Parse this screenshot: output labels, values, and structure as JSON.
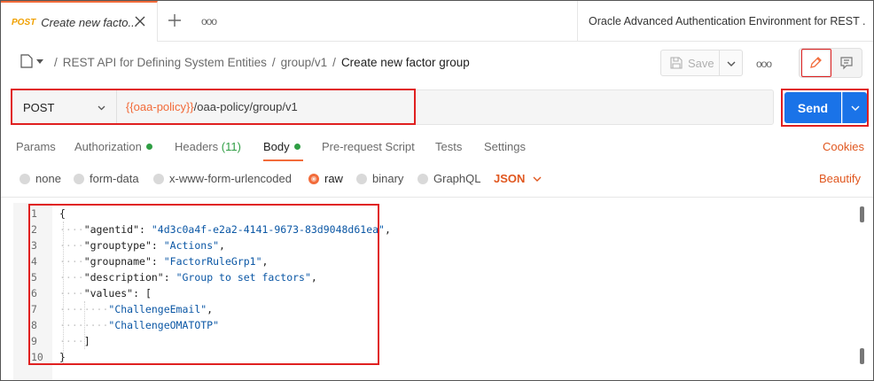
{
  "tab": {
    "method": "POST",
    "name": "Create new facto...",
    "method_color": "#f0a000"
  },
  "environment": {
    "name": "Oracle Advanced Authentication Environment for REST ."
  },
  "breadcrumb": {
    "collection": "REST API for Defining System Entities",
    "folder": "group/v1",
    "request": "Create new factor group",
    "sep": "/"
  },
  "toolbar": {
    "save_label": "Save"
  },
  "request": {
    "method": "POST",
    "url_variable": "{{oaa-policy}}",
    "url_path": "/oaa-policy/group/v1",
    "send_label": "Send"
  },
  "request_tabs": [
    {
      "label": "Params"
    },
    {
      "label": "Authorization"
    },
    {
      "label": "Headers"
    },
    {
      "label": "Body"
    },
    {
      "label": "Pre-request Script"
    },
    {
      "label": "Tests"
    },
    {
      "label": "Settings"
    }
  ],
  "headers_count": "(11)",
  "cookies_label": "Cookies",
  "body_options": [
    {
      "label": "none"
    },
    {
      "label": "form-data"
    },
    {
      "label": "x-www-form-urlencoded"
    },
    {
      "label": "raw"
    },
    {
      "label": "binary"
    },
    {
      "label": "GraphQL"
    }
  ],
  "body_format": "JSON",
  "beautify_label": "Beautify",
  "colors": {
    "accent": "#f26b3a",
    "send": "#1a73e8",
    "status_green": "#2f9e44",
    "highlight_red": "#e02020"
  },
  "code": {
    "line_numbers": [
      "1",
      "2",
      "3",
      "4",
      "5",
      "6",
      "7",
      "8",
      "9",
      "10"
    ],
    "open_brace": "{",
    "close_brace": "}",
    "agentid_key": "\"agentid\"",
    "agentid_val": "\"4d3c0a4f-e2a2-4141-9673-83d9048d61ea\"",
    "grouptype_key": "\"grouptype\"",
    "grouptype_val": "\"Actions\"",
    "groupname_key": "\"groupname\"",
    "groupname_val": "\"FactorRuleGrp1\"",
    "description_key": "\"description\"",
    "description_val": "\"Group to set factors\"",
    "values_key": "\"values\"",
    "values_open": "[",
    "values_item1": "\"ChallengeEmail\"",
    "values_item2": "\"ChallengeOMATOTP\"",
    "values_close": "]"
  }
}
